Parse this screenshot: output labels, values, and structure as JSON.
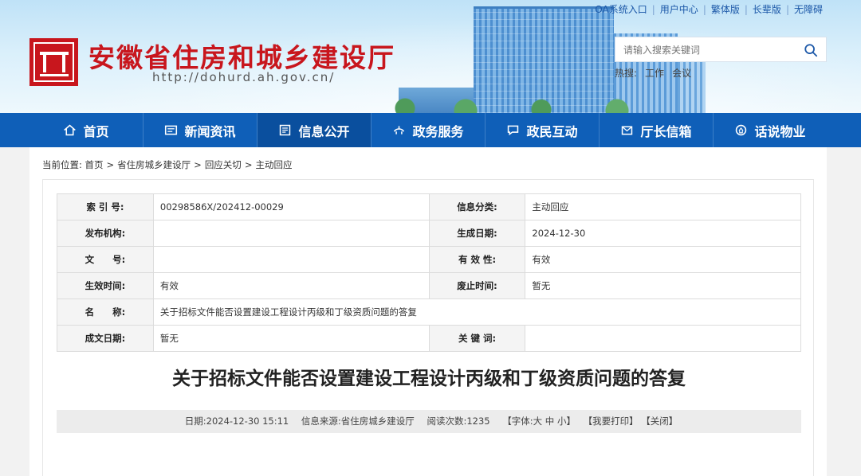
{
  "header": {
    "site_title": "安徽省住房和城乡建设厅",
    "site_url": "http://dohurd.ah.gov.cn/",
    "top_links": [
      "OA系统入口",
      "用户中心",
      "繁体版",
      "长辈版",
      "无障碍"
    ],
    "search_placeholder": "请输入搜索关键词",
    "hot_label": "热搜:",
    "hot_terms": [
      "工作",
      "会议"
    ]
  },
  "nav": {
    "items": [
      {
        "label": "首页",
        "icon": "home-icon"
      },
      {
        "label": "新闻资讯",
        "icon": "news-icon"
      },
      {
        "label": "信息公开",
        "icon": "info-icon"
      },
      {
        "label": "政务服务",
        "icon": "service-icon"
      },
      {
        "label": "政民互动",
        "icon": "chat-icon"
      },
      {
        "label": "厅长信箱",
        "icon": "mailbox-icon"
      },
      {
        "label": "话说物业",
        "icon": "property-icon"
      }
    ],
    "active_index": 2
  },
  "breadcrumb": {
    "prefix": "当前位置:",
    "items": [
      "首页",
      "省住房城乡建设厅",
      "回应关切",
      "主动回应"
    ],
    "separator": ">"
  },
  "meta_table": {
    "rows": [
      [
        {
          "label": "索 引 号:",
          "value": "00298586X/202412-00029"
        },
        {
          "label": "信息分类:",
          "value": "主动回应"
        }
      ],
      [
        {
          "label": "发布机构:",
          "value": ""
        },
        {
          "label": "生成日期:",
          "value": "2024-12-30"
        }
      ],
      [
        {
          "label": "文　　号:",
          "value": ""
        },
        {
          "label": "有 效 性:",
          "value": "有效"
        }
      ],
      [
        {
          "label": "生效时间:",
          "value": "有效"
        },
        {
          "label": "废止时间:",
          "value": "暂无"
        }
      ],
      [
        {
          "label": "名　　称:",
          "value": "关于招标文件能否设置建设工程设计丙级和丁级资质问题的答复"
        }
      ],
      [
        {
          "label": "成文日期:",
          "value": "暂无"
        },
        {
          "label": "关 键 词:",
          "value": ""
        }
      ]
    ]
  },
  "article": {
    "title": "关于招标文件能否设置建设工程设计丙级和丁级资质问题的答复",
    "date": "日期:2024-12-30 15:11",
    "source": "信息来源:省住房城乡建设厅",
    "views": "阅读次数:1235",
    "font_label": "【字体:",
    "font_sizes": [
      "大",
      "中",
      "小"
    ],
    "font_close": "】",
    "print": "【我要打印】",
    "close": "【关闭】"
  },
  "colors": {
    "brand_red": "#c8161d",
    "nav_blue": "#0f5fb8",
    "nav_active": "#0a4f9e"
  }
}
